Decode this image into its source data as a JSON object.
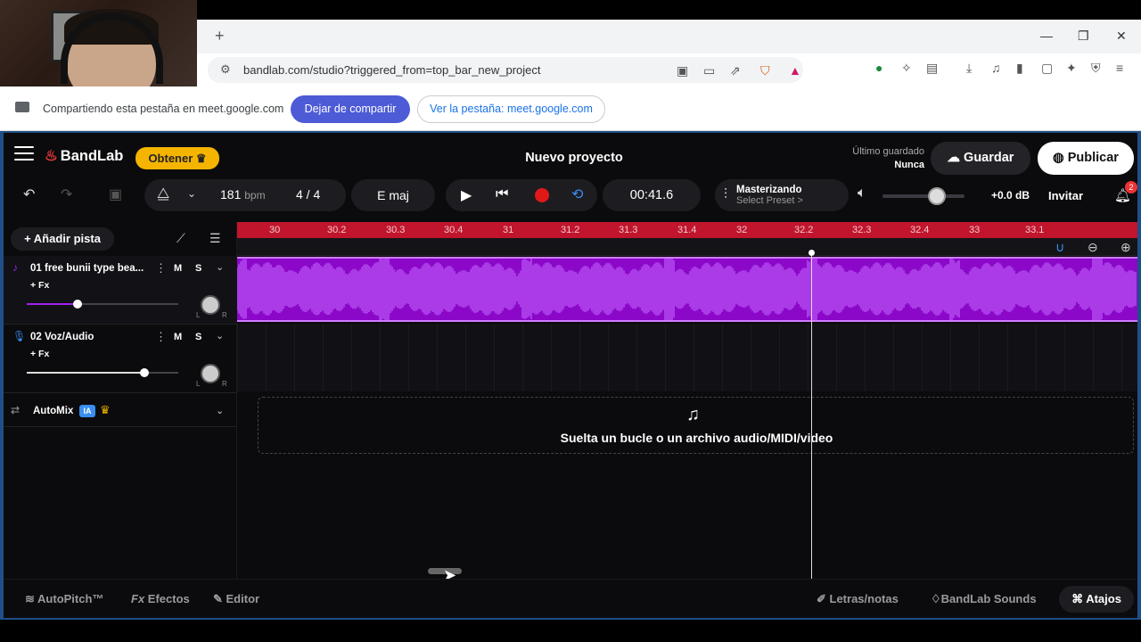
{
  "browser": {
    "new_tab_glyph": "+",
    "url": "bandlab.com/studio?triggered_from=top_bar_new_project",
    "window_controls": {
      "minimize": "—",
      "restore": "❐",
      "close": "✕"
    }
  },
  "share_bar": {
    "text": "Compartiendo esta pestaña en meet.google.com",
    "stop_button": "Dejar de compartir",
    "view_tab_button": "Ver la pestaña: meet.google.com"
  },
  "app": {
    "brand": "BandLab",
    "get_button": "Obtener",
    "project_title": "Nuevo proyecto",
    "save_status_label": "Último guardado",
    "save_status_value": "Nunca",
    "save_button": "Guardar",
    "publish_button": "Publicar"
  },
  "transport": {
    "bpm_value": "181",
    "bpm_unit": "bpm",
    "time_signature": "4 / 4",
    "key": "E maj",
    "time": "00:41.6",
    "mastering_title": "Masterizando",
    "mastering_preset": "Select Preset >",
    "volume_level": 0.6,
    "db": "+0.0 dB",
    "invite_button": "Invitar",
    "notifications_count": "2"
  },
  "tracks_panel": {
    "add_track": "Añadir pista",
    "tracks": [
      {
        "name": "01  free bunii type bea...",
        "mute": "M",
        "solo": "S",
        "fx": "+ Fx",
        "volume": 0.33,
        "color": "#a020f0"
      },
      {
        "name": "02  Voz/Audio",
        "mute": "M",
        "solo": "S",
        "fx": "+ Fx",
        "volume": 0.78,
        "color": "#3a8ef0"
      }
    ],
    "automix": {
      "label": "AutoMix",
      "badge": "IA"
    }
  },
  "timeline": {
    "ruler_ticks": [
      "30",
      "30.2",
      "30.3",
      "30.4",
      "31",
      "31.2",
      "31.3",
      "31.4",
      "32",
      "32.2",
      "32.3",
      "32.4",
      "33",
      "33.1"
    ],
    "drop_text": "Suelta un bucle o un archivo audio/MIDI/video"
  },
  "bottom": {
    "autopitch": "AutoPitch™",
    "effects": "Efectos",
    "editor": "Editor",
    "lyrics": "Letras/notas",
    "sounds": "BandLab Sounds",
    "shortcuts": "Atajos"
  },
  "colors": {
    "accent_red": "#c0152d",
    "track1_purple": "#8b08c9",
    "frame_blue": "#1f4f88",
    "get_yellow": "#f4b400"
  }
}
